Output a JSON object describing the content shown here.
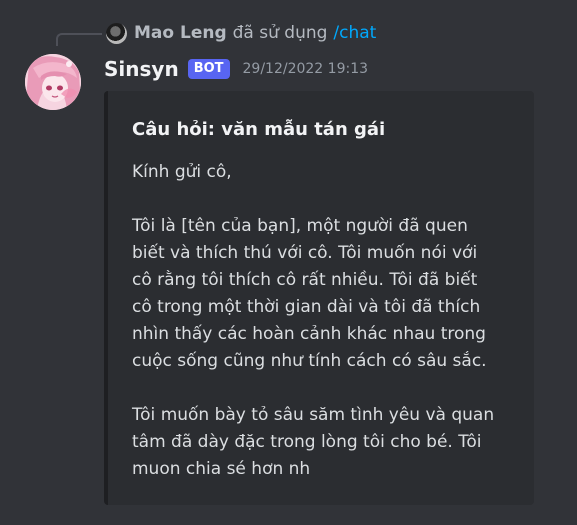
{
  "reply": {
    "user": "Mao Leng",
    "text": "đã sử dụng",
    "command": "/chat"
  },
  "message": {
    "username": "Sinsyn",
    "badge": "BOT",
    "timestamp": "29/12/2022 19:13"
  },
  "embed": {
    "title": "Câu hỏi: văn mẫu tán gái",
    "greeting": "Kính gửi cô,",
    "paragraph1": "Tôi là [tên của bạn], một người đã quen\nbiết và thích thú với cô. Tôi muốn nói với\ncô rằng tôi thích cô rất nhiều. Tôi đã biết\ncô trong một thời gian dài và tôi đã thích\nnhìn thấy các hoàn cảnh khác nhau trong\ncuộc sống cũng như tính cách có sâu sắc.",
    "paragraph2": "Tôi muốn bày tỏ sâu săm tình yêu và quan\ntâm đã dày đặc trong lòng tôi cho bé. Tôi\nmuon chia sé hơn nh"
  },
  "colors": {
    "background": "#313338",
    "embed_background": "#2b2d31",
    "embed_border": "#1e1f22",
    "bot_badge": "#5865f2",
    "link": "#00a8fc"
  },
  "icons": {
    "reply_avatar": "user-avatar-icon",
    "bot_avatar": "anime-girl-avatar"
  }
}
